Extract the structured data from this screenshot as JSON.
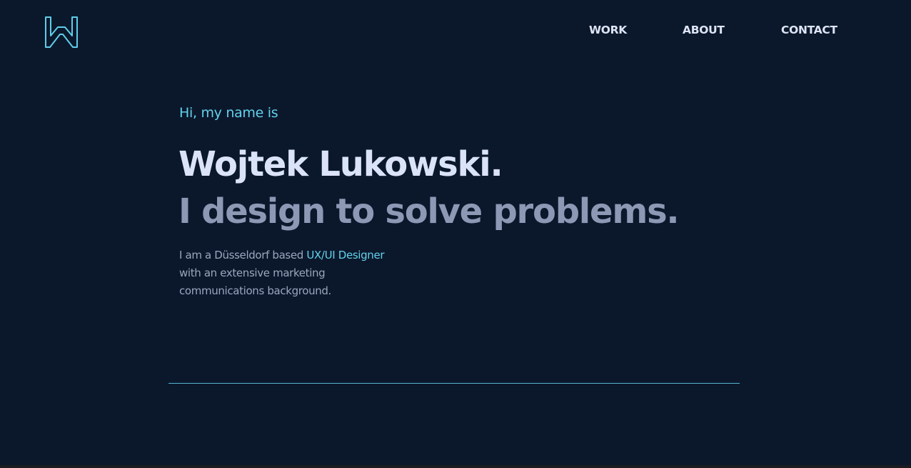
{
  "brand": {
    "logo_icon": "wl-monogram-logo",
    "accent_color": "#63d0ec",
    "background_color": "#0b182b"
  },
  "nav": {
    "items": [
      {
        "label": "WORK"
      },
      {
        "label": "ABOUT"
      },
      {
        "label": "CONTACT"
      }
    ]
  },
  "hero": {
    "greeting": "Hi, my name is",
    "name": "Wojtek Lukowski.",
    "tagline": "I design to solve problems.",
    "intro": {
      "before": "I am a Düsseldorf based ",
      "highlight": "UX/UI Designer",
      "after": " with an extensive marketing communications background."
    }
  }
}
